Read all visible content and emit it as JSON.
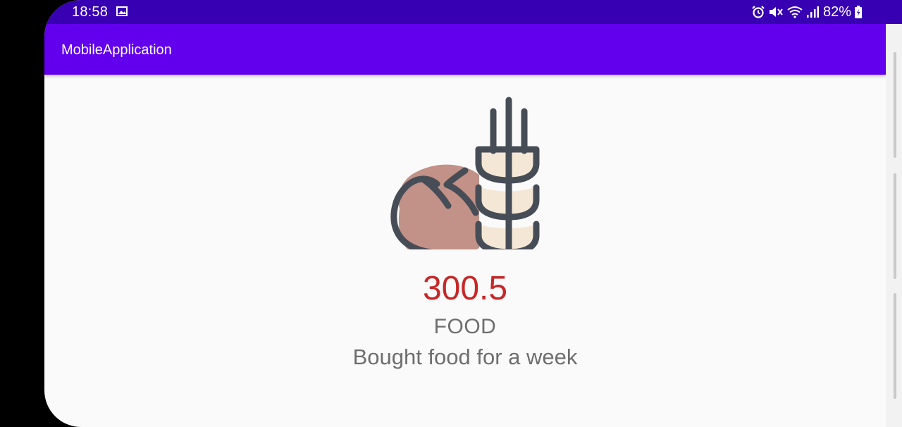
{
  "status_bar": {
    "time": "18:58",
    "battery": "82%",
    "icons": [
      "image-icon",
      "alarm-icon",
      "mute-icon",
      "wifi-icon",
      "signal-icon",
      "battery-icon"
    ]
  },
  "app_bar": {
    "title": "MobileApplication"
  },
  "colors": {
    "status_bar": "#3700b3",
    "app_bar": "#6200ee",
    "amount": "#c62828",
    "secondary_text": "#6e6e6e",
    "bread": "#c29187",
    "wheat": "#f5e7d5",
    "outline": "#474d56"
  },
  "transaction": {
    "icon": "bread-wheat-icon",
    "amount": "300.5",
    "category": "FOOD",
    "description": "Bought food for a week"
  }
}
